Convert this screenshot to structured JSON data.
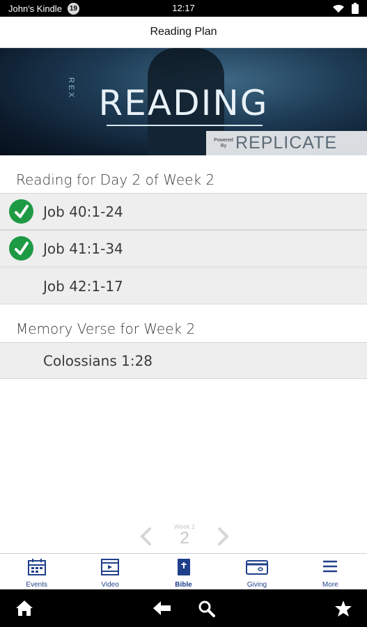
{
  "status_bar": {
    "device_name": "John's Kindle",
    "notification_count": "19",
    "time": "12:17"
  },
  "header": {
    "title": "Reading Plan"
  },
  "banner": {
    "vertical_text": "REX",
    "word": "READING",
    "powered_by": "Powered By",
    "brand_name": "REPLICATE"
  },
  "reading": {
    "heading": "Reading for Day 2 of Week 2",
    "items": [
      {
        "label": "Job 40:1-24",
        "completed": true
      },
      {
        "label": "Job 41:1-34",
        "completed": true
      },
      {
        "label": "Job 42:1-17",
        "completed": false
      }
    ]
  },
  "memory": {
    "heading": "Memory Verse for Week 2",
    "items": [
      {
        "label": "Colossians 1:28"
      }
    ]
  },
  "pager": {
    "week_label": "Week 2",
    "week_number": "2"
  },
  "tabs": [
    {
      "label": "Events",
      "icon": "calendar-icon"
    },
    {
      "label": "Video",
      "icon": "film-icon"
    },
    {
      "label": "Bible",
      "icon": "bible-icon",
      "active": true
    },
    {
      "label": "Giving",
      "icon": "card-icon"
    },
    {
      "label": "More",
      "icon": "menu-icon"
    }
  ],
  "colors": {
    "check_green": "#1e9a44",
    "tab_blue": "#1f3f8a",
    "row_gray": "#eeeeee"
  }
}
